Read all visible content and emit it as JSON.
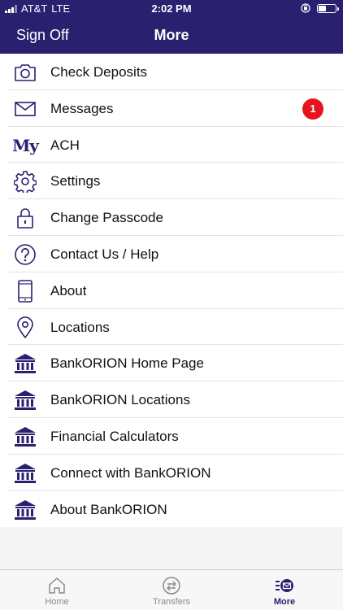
{
  "status": {
    "carrier": "AT&T",
    "network": "LTE",
    "time": "2:02 PM",
    "battery_level": 0.45
  },
  "navbar": {
    "left_button": "Sign Off",
    "title": "More"
  },
  "menu": [
    {
      "label": "Check Deposits",
      "icon": "camera-icon"
    },
    {
      "label": "Messages",
      "icon": "envelope-icon",
      "badge": "1"
    },
    {
      "label": "ACH",
      "icon": "my-icon",
      "icon_text": "My"
    },
    {
      "label": "Settings",
      "icon": "gear-icon"
    },
    {
      "label": "Change Passcode",
      "icon": "lock-icon"
    },
    {
      "label": "Contact Us / Help",
      "icon": "question-circle-icon"
    },
    {
      "label": "About",
      "icon": "phone-icon"
    },
    {
      "label": "Locations",
      "icon": "map-pin-icon"
    },
    {
      "label": "BankORION Home Page",
      "icon": "bank-icon"
    },
    {
      "label": "BankORION Locations",
      "icon": "bank-icon"
    },
    {
      "label": "Financial Calculators",
      "icon": "bank-icon"
    },
    {
      "label": "Connect with BankORION",
      "icon": "bank-icon"
    },
    {
      "label": "About BankORION",
      "icon": "bank-icon"
    }
  ],
  "tabs": [
    {
      "label": "Home",
      "icon": "home-icon",
      "active": false
    },
    {
      "label": "Transfers",
      "icon": "transfers-icon",
      "active": false
    },
    {
      "label": "More",
      "icon": "more-icon",
      "active": true
    }
  ],
  "colors": {
    "brand": "#2a2070",
    "badge": "#e8141b",
    "background": "#f4f4f4"
  }
}
